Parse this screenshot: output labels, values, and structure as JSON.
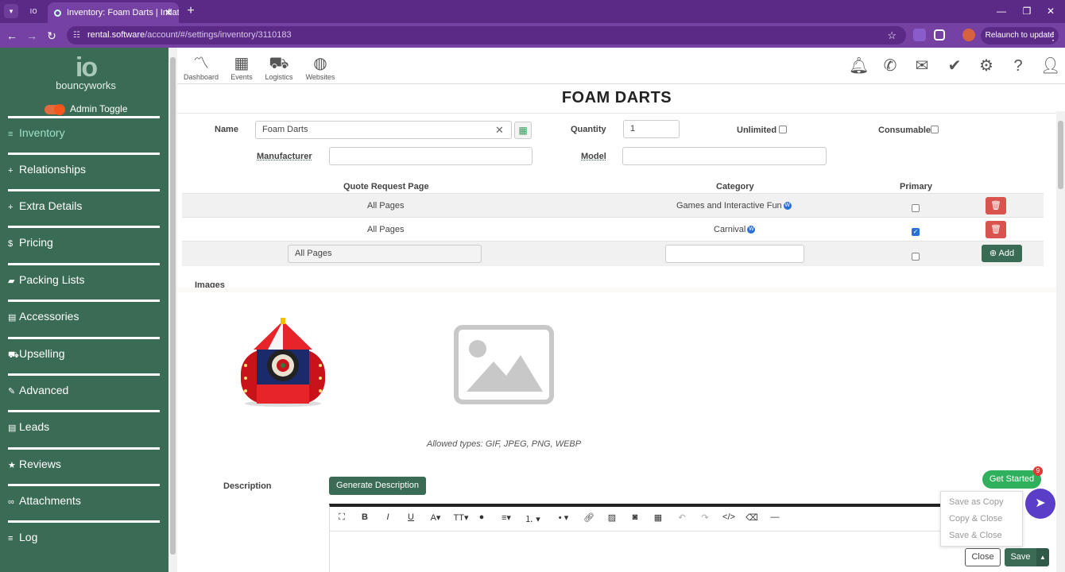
{
  "browser": {
    "tab_title": "Inventory: Foam Darts | Inflatab",
    "url_host": "rental.software",
    "url_path": "/account/#/settings/inventory/3110183",
    "relaunch_label": "Relaunch to update"
  },
  "sidebar": {
    "logo_mark": "io",
    "logo_text": "bouncyworks",
    "admin_toggle_label": "Admin Toggle",
    "items": [
      {
        "label": "Inventory",
        "icon": "list-icon"
      },
      {
        "label": "Relationships",
        "icon": "plus-icon"
      },
      {
        "label": "Extra Details",
        "icon": "plus-icon"
      },
      {
        "label": "Pricing",
        "icon": "dollar-icon"
      },
      {
        "label": "Packing Lists",
        "icon": "truck-icon"
      },
      {
        "label": "Accessories",
        "icon": "list-alt-icon"
      },
      {
        "label": "Upselling",
        "icon": "cart-icon"
      },
      {
        "label": "Advanced",
        "icon": "wrench-icon"
      },
      {
        "label": "Leads",
        "icon": "list-alt-icon"
      },
      {
        "label": "Reviews",
        "icon": "star-icon"
      },
      {
        "label": "Attachments",
        "icon": "link-icon"
      },
      {
        "label": "Log",
        "icon": "list-icon"
      }
    ]
  },
  "topnav": {
    "items": [
      {
        "label": "Dashboard",
        "icon": "chart-icon"
      },
      {
        "label": "Events",
        "icon": "calendar-icon"
      },
      {
        "label": "Logistics",
        "icon": "truck-icon"
      },
      {
        "label": "Websites",
        "icon": "globe-icon"
      }
    ],
    "right_icons": [
      "bell-icon",
      "phone-icon",
      "envelope-icon",
      "check-icon",
      "gear-icon",
      "question-icon",
      "user-icon"
    ]
  },
  "form": {
    "title": "FOAM DARTS",
    "name_label": "Name",
    "name_value": "Foam Darts",
    "quantity_label": "Quantity",
    "quantity_value": "1",
    "unlimited_label": "Unlimited",
    "consumable_label": "Consumable",
    "manufacturer_label": "Manufacturer",
    "manufacturer_value": "",
    "model_label": "Model",
    "model_value": ""
  },
  "categories_table": {
    "headers": [
      "Quote Request Page",
      "Category",
      "Primary"
    ],
    "rows": [
      {
        "page": "All Pages",
        "category": "Games and Interactive Fun",
        "primary": false
      },
      {
        "page": "All Pages",
        "category": "Carnival",
        "primary": true
      }
    ],
    "new_row": {
      "page_value": "All Pages",
      "category_value": "",
      "add_label": "Add"
    }
  },
  "images": {
    "label": "Images",
    "allowed_types": "Allowed types: GIF, JPEG, PNG, WEBP"
  },
  "description": {
    "label": "Description",
    "generate_label": "Generate Description"
  },
  "save_menu": {
    "items": [
      "Save as Copy",
      "Copy & Close",
      "Save & Close"
    ],
    "close_label": "Close",
    "save_label": "Save"
  },
  "widgets": {
    "get_started_label": "Get Started",
    "get_started_badge": "9"
  },
  "colors": {
    "browser_purple": "#7542a3",
    "sidebar_green": "#3a6b55",
    "delete_red": "#d9534f",
    "accent_green": "#2fb05c"
  }
}
